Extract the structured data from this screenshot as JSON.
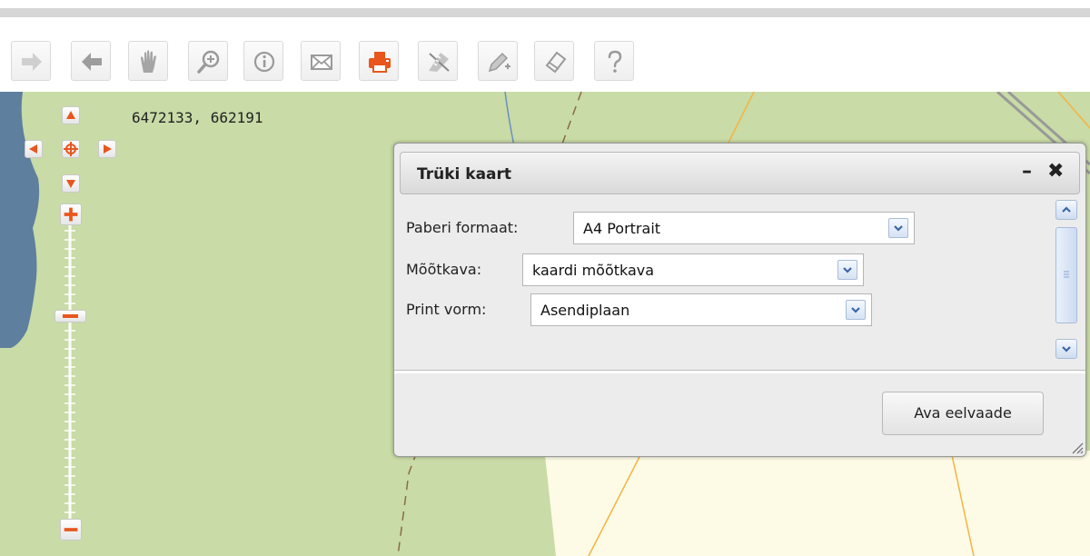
{
  "toolbar": {
    "buttons": [
      {
        "icon": "arrow-right-icon",
        "name": "forward"
      },
      {
        "icon": "arrow-left-icon",
        "name": "back"
      },
      {
        "icon": "hand-icon",
        "name": "pan"
      },
      {
        "icon": "zoom-in-icon",
        "name": "zoom"
      },
      {
        "icon": "info-icon",
        "name": "info"
      },
      {
        "icon": "mail-icon",
        "name": "email"
      },
      {
        "icon": "printer-icon",
        "name": "print"
      },
      {
        "icon": "measure-icon",
        "name": "measure"
      },
      {
        "icon": "draw-icon",
        "name": "draw"
      },
      {
        "icon": "eraser-icon",
        "name": "erase"
      },
      {
        "icon": "help-icon",
        "name": "help"
      }
    ],
    "active_color": "#e8561d",
    "icon_color": "#b9b9b9"
  },
  "map": {
    "coordinates": "6472133, 662191",
    "colors": {
      "land": "#c9dba6",
      "field": "#fdfbe6",
      "water": "#5e7f9e",
      "road": "#f5a623"
    }
  },
  "dialog": {
    "title": "Trüki kaart",
    "minimize": "–",
    "close": "✖",
    "fields": [
      {
        "label": "Paberi formaat:",
        "value": "A4 Portrait"
      },
      {
        "label": "Mõõtkava:",
        "value": "kaardi mõõtkava"
      },
      {
        "label": "Print vorm:",
        "value": "Asendiplaan"
      }
    ],
    "preview_button": "Ava eelvaade"
  }
}
